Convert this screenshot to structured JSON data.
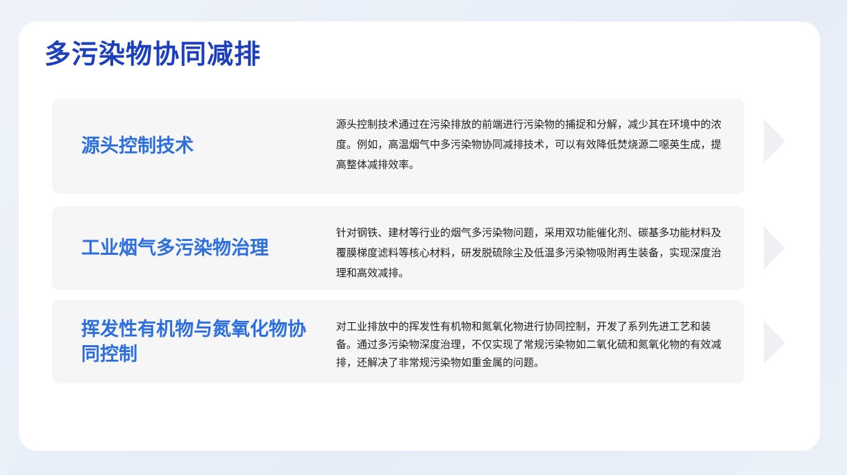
{
  "slide": {
    "title": "多污染物协同减排",
    "items": [
      {
        "heading": "源头控制技术",
        "description": "源头控制技术通过在污染排放的前端进行污染物的捕捉和分解，减少其在环境中的浓度。例如，高温烟气中多污染物协同减排技术，可以有效降低焚烧源二噁英生成，提高整体减排效率。"
      },
      {
        "heading": "工业烟气多污染物治理",
        "description": "针对钢铁、建材等行业的烟气多污染物问题，采用双功能催化剂、碳基多功能材料及覆膜梯度滤料等核心材料，研发脱硫除尘及低温多污染物吸附再生装备，实现深度治理和高效减排。"
      },
      {
        "heading": "挥发性有机物与氮氧化物协同控制",
        "description": "对工业排放中的挥发性有机物和氮氧化物进行协同控制，开发了系列先进工艺和装备。通过多污染物深度治理，不仅实现了常规污染物如二氧化硫和氮氧化物的有效减排，还解决了非常规污染物如重金属的问题。"
      }
    ],
    "icons": [
      "chevron-right-icon",
      "chevron-right-icon",
      "chevron-right-icon"
    ],
    "colors": {
      "title": "#1c3fc0",
      "heading": "#2d6fe0",
      "row_background": "#f6f6f6",
      "page_background": "#e8eef7"
    }
  }
}
